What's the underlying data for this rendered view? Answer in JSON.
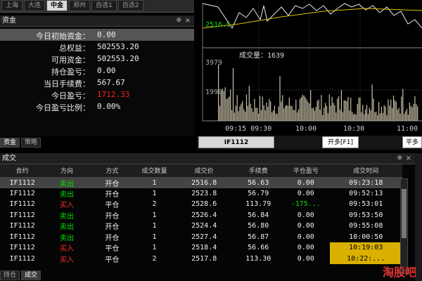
{
  "top_tabs": [
    "上海",
    "大连",
    "中金",
    "郑州",
    "自选1",
    "自选2"
  ],
  "top_active": 2,
  "fund_panel": {
    "title": "资金",
    "pin": "⊕",
    "close": "×",
    "rows": [
      {
        "label": "今日初始资金：",
        "value": "0.00",
        "highlight": true,
        "red": false
      },
      {
        "label": "总权益：",
        "value": "502553.20",
        "highlight": false,
        "red": false
      },
      {
        "label": "可用资金：",
        "value": "502553.20",
        "highlight": false,
        "red": false
      },
      {
        "label": "持仓盈亏：",
        "value": "0.00",
        "highlight": false,
        "red": false
      },
      {
        "label": "当日手续费：",
        "value": "567.67",
        "highlight": false,
        "red": false
      },
      {
        "label": "今日盈亏：",
        "value": "1712.33",
        "highlight": false,
        "red": true
      },
      {
        "label": "今日盈亏比例：",
        "value": "0.00%",
        "highlight": false,
        "red": false
      }
    ],
    "bottom_tabs": [
      "资金",
      "策略"
    ]
  },
  "chart": {
    "price_label": "2516.5",
    "volume_title": "成交量：1639",
    "volume_max": "3979",
    "volume_mid": "1990",
    "time_labels": [
      "09:15 09:30",
      "10:00",
      "10:30",
      "11:00"
    ]
  },
  "order_bar": {
    "symbol": "IF1112",
    "button1": "开多[F1]",
    "button2": "平多"
  },
  "trades_panel": {
    "title": "成交",
    "pin": "⊕",
    "close": "×",
    "headers": [
      "合约",
      "方向",
      "方式",
      "成交数量",
      "成交价",
      "手续费",
      "平仓盈亏",
      "成交时间"
    ],
    "rows": [
      {
        "sym": "IF1112",
        "dir": "卖出",
        "mode": "开仓",
        "qty": "1",
        "price": "2516.8",
        "fee": "56.63",
        "pnl": "0.00",
        "time": "09:23:18"
      },
      {
        "sym": "IF1112",
        "dir": "卖出",
        "mode": "开仓",
        "qty": "1",
        "price": "2523.8",
        "fee": "56.79",
        "pnl": "0.00",
        "time": "09:52:13"
      },
      {
        "sym": "IF1112",
        "dir": "买入",
        "mode": "平仓",
        "qty": "2",
        "price": "2528.6",
        "fee": "113.79",
        "pnl": "-175...",
        "time": "09:53:01"
      },
      {
        "sym": "IF1112",
        "dir": "卖出",
        "mode": "开仓",
        "qty": "1",
        "price": "2526.4",
        "fee": "56.84",
        "pnl": "0.00",
        "time": "09:53:50"
      },
      {
        "sym": "IF1112",
        "dir": "卖出",
        "mode": "开仓",
        "qty": "1",
        "price": "2524.4",
        "fee": "56.80",
        "pnl": "0.00",
        "time": "09:55:08"
      },
      {
        "sym": "IF1112",
        "dir": "卖出",
        "mode": "开仓",
        "qty": "1",
        "price": "2527.4",
        "fee": "56.87",
        "pnl": "0.00",
        "time": "10:00:50"
      },
      {
        "sym": "IF1112",
        "dir": "买入",
        "mode": "平仓",
        "qty": "1",
        "price": "2518.4",
        "fee": "56.66",
        "pnl": "0.00",
        "time": "10:19:03"
      },
      {
        "sym": "IF1112",
        "dir": "买入",
        "mode": "平仓",
        "qty": "2",
        "price": "2517.8",
        "fee": "113.30",
        "pnl": "0.00",
        "time": "10:22:..."
      }
    ],
    "bottom_tabs": [
      "持仓",
      "成交"
    ]
  },
  "watermark": "淘股吧"
}
